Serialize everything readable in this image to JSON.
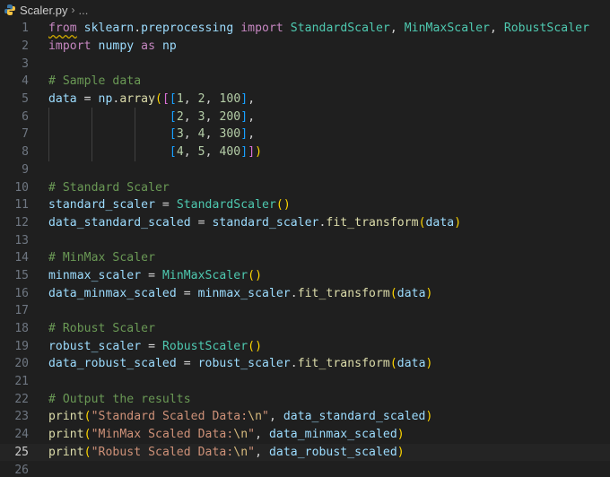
{
  "breadcrumb": {
    "filename": "Scaler.py",
    "more": "..."
  },
  "colors": {
    "background": "#1f1f1f",
    "keyword": "#c586c0",
    "function": "#dcdcaa",
    "class": "#4ec9b0",
    "variable": "#9cdcfe",
    "number": "#b5cea8",
    "string": "#ce9178",
    "comment": "#6a9955"
  },
  "editor": {
    "active_line": 25,
    "lines": [
      [
        [
          "kw squiggle",
          "from"
        ],
        [
          "op",
          " "
        ],
        [
          "var",
          "sklearn"
        ],
        [
          "op",
          "."
        ],
        [
          "var",
          "preprocessing"
        ],
        [
          "op",
          " "
        ],
        [
          "kw",
          "import"
        ],
        [
          "op",
          " "
        ],
        [
          "cls",
          "StandardScaler"
        ],
        [
          "op",
          ", "
        ],
        [
          "cls",
          "MinMaxScaler"
        ],
        [
          "op",
          ", "
        ],
        [
          "cls",
          "RobustScaler"
        ]
      ],
      [
        [
          "kw",
          "import"
        ],
        [
          "op",
          " "
        ],
        [
          "var",
          "numpy"
        ],
        [
          "op",
          " "
        ],
        [
          "kw",
          "as"
        ],
        [
          "op",
          " "
        ],
        [
          "var",
          "np"
        ]
      ],
      [],
      [
        [
          "com",
          "# Sample data"
        ]
      ],
      [
        [
          "var",
          "data"
        ],
        [
          "op",
          " = "
        ],
        [
          "var",
          "np"
        ],
        [
          "op",
          "."
        ],
        [
          "fn",
          "array"
        ],
        [
          "b1",
          "("
        ],
        [
          "b2",
          "["
        ],
        [
          "b3",
          "["
        ],
        [
          "num",
          "1"
        ],
        [
          "op",
          ", "
        ],
        [
          "num",
          "2"
        ],
        [
          "op",
          ", "
        ],
        [
          "num",
          "100"
        ],
        [
          "b3",
          "]"
        ],
        [
          "op",
          ","
        ]
      ],
      [
        [
          "op",
          "                 "
        ],
        [
          "b3",
          "["
        ],
        [
          "num",
          "2"
        ],
        [
          "op",
          ", "
        ],
        [
          "num",
          "3"
        ],
        [
          "op",
          ", "
        ],
        [
          "num",
          "200"
        ],
        [
          "b3",
          "]"
        ],
        [
          "op",
          ","
        ]
      ],
      [
        [
          "op",
          "                 "
        ],
        [
          "b3",
          "["
        ],
        [
          "num",
          "3"
        ],
        [
          "op",
          ", "
        ],
        [
          "num",
          "4"
        ],
        [
          "op",
          ", "
        ],
        [
          "num",
          "300"
        ],
        [
          "b3",
          "]"
        ],
        [
          "op",
          ","
        ]
      ],
      [
        [
          "op",
          "                 "
        ],
        [
          "b3",
          "["
        ],
        [
          "num",
          "4"
        ],
        [
          "op",
          ", "
        ],
        [
          "num",
          "5"
        ],
        [
          "op",
          ", "
        ],
        [
          "num",
          "400"
        ],
        [
          "b3",
          "]"
        ],
        [
          "b2",
          "]"
        ],
        [
          "b1",
          ")"
        ]
      ],
      [],
      [
        [
          "com",
          "# Standard Scaler"
        ]
      ],
      [
        [
          "var",
          "standard_scaler"
        ],
        [
          "op",
          " = "
        ],
        [
          "cls",
          "StandardScaler"
        ],
        [
          "b1",
          "()"
        ]
      ],
      [
        [
          "var",
          "data_standard_scaled"
        ],
        [
          "op",
          " = "
        ],
        [
          "var",
          "standard_scaler"
        ],
        [
          "op",
          "."
        ],
        [
          "fn",
          "fit_transform"
        ],
        [
          "b1",
          "("
        ],
        [
          "var",
          "data"
        ],
        [
          "b1",
          ")"
        ]
      ],
      [],
      [
        [
          "com",
          "# MinMax Scaler"
        ]
      ],
      [
        [
          "var",
          "minmax_scaler"
        ],
        [
          "op",
          " = "
        ],
        [
          "cls",
          "MinMaxScaler"
        ],
        [
          "b1",
          "()"
        ]
      ],
      [
        [
          "var",
          "data_minmax_scaled"
        ],
        [
          "op",
          " = "
        ],
        [
          "var",
          "minmax_scaler"
        ],
        [
          "op",
          "."
        ],
        [
          "fn",
          "fit_transform"
        ],
        [
          "b1",
          "("
        ],
        [
          "var",
          "data"
        ],
        [
          "b1",
          ")"
        ]
      ],
      [],
      [
        [
          "com",
          "# Robust Scaler"
        ]
      ],
      [
        [
          "var",
          "robust_scaler"
        ],
        [
          "op",
          " = "
        ],
        [
          "cls",
          "RobustScaler"
        ],
        [
          "b1",
          "()"
        ]
      ],
      [
        [
          "var",
          "data_robust_scaled"
        ],
        [
          "op",
          " = "
        ],
        [
          "var",
          "robust_scaler"
        ],
        [
          "op",
          "."
        ],
        [
          "fn",
          "fit_transform"
        ],
        [
          "b1",
          "("
        ],
        [
          "var",
          "data"
        ],
        [
          "b1",
          ")"
        ]
      ],
      [],
      [
        [
          "com",
          "# Output the results"
        ]
      ],
      [
        [
          "fn",
          "print"
        ],
        [
          "b1",
          "("
        ],
        [
          "str",
          "\"Standard Scaled Data:"
        ],
        [
          "esc",
          "\\n"
        ],
        [
          "str",
          "\""
        ],
        [
          "op",
          ", "
        ],
        [
          "var",
          "data_standard_scaled"
        ],
        [
          "b1",
          ")"
        ]
      ],
      [
        [
          "fn",
          "print"
        ],
        [
          "b1",
          "("
        ],
        [
          "str",
          "\"MinMax Scaled Data:"
        ],
        [
          "esc",
          "\\n"
        ],
        [
          "str",
          "\""
        ],
        [
          "op",
          ", "
        ],
        [
          "var",
          "data_minmax_scaled"
        ],
        [
          "b1",
          ")"
        ]
      ],
      [
        [
          "fn",
          "print"
        ],
        [
          "b1",
          "("
        ],
        [
          "str",
          "\"Robust Scaled Data:"
        ],
        [
          "esc",
          "\\n"
        ],
        [
          "str",
          "\""
        ],
        [
          "op",
          ", "
        ],
        [
          "var",
          "data_robust_scaled"
        ],
        [
          "b1",
          ")"
        ]
      ],
      []
    ]
  }
}
